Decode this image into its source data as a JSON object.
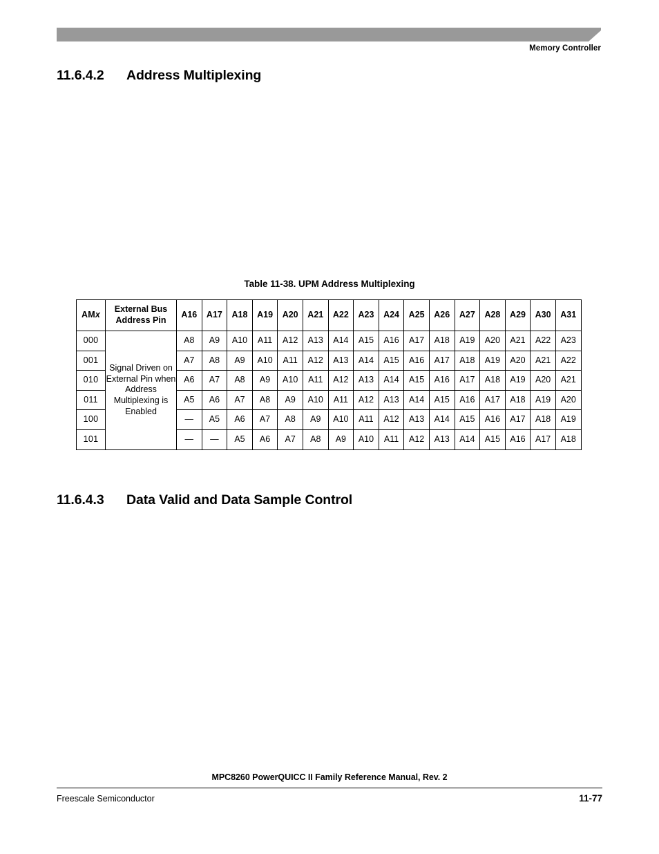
{
  "page": {
    "running_head": "Memory Controller",
    "banner_color": "#999999"
  },
  "sections": [
    {
      "number": "11.6.4.2",
      "title": "Address Multiplexing"
    },
    {
      "number": "11.6.4.3",
      "title": "Data Valid and Data Sample Control"
    }
  ],
  "table": {
    "caption": "Table 11-38. UPM Address Multiplexing",
    "headers": {
      "amx": "AM",
      "amx_italic_suffix": "x",
      "description": "External Bus Address Pin",
      "address_pins": [
        "A16",
        "A17",
        "A18",
        "A19",
        "A20",
        "A21",
        "A22",
        "A23",
        "A24",
        "A25",
        "A26",
        "A27",
        "A28",
        "A29",
        "A30",
        "A31"
      ]
    },
    "merged_description": "Signal Driven on External Pin when Address Multiplexing is Enabled",
    "rows": [
      {
        "amx": "000",
        "values": [
          "A8",
          "A9",
          "A10",
          "A11",
          "A12",
          "A13",
          "A14",
          "A15",
          "A16",
          "A17",
          "A18",
          "A19",
          "A20",
          "A21",
          "A22",
          "A23"
        ]
      },
      {
        "amx": "001",
        "values": [
          "A7",
          "A8",
          "A9",
          "A10",
          "A11",
          "A12",
          "A13",
          "A14",
          "A15",
          "A16",
          "A17",
          "A18",
          "A19",
          "A20",
          "A21",
          "A22"
        ]
      },
      {
        "amx": "010",
        "values": [
          "A6",
          "A7",
          "A8",
          "A9",
          "A10",
          "A11",
          "A12",
          "A13",
          "A14",
          "A15",
          "A16",
          "A17",
          "A18",
          "A19",
          "A20",
          "A21"
        ]
      },
      {
        "amx": "011",
        "values": [
          "A5",
          "A6",
          "A7",
          "A8",
          "A9",
          "A10",
          "A11",
          "A12",
          "A13",
          "A14",
          "A15",
          "A16",
          "A17",
          "A18",
          "A19",
          "A20"
        ]
      },
      {
        "amx": "100",
        "values": [
          "—",
          "A5",
          "A6",
          "A7",
          "A8",
          "A9",
          "A10",
          "A11",
          "A12",
          "A13",
          "A14",
          "A15",
          "A16",
          "A17",
          "A18",
          "A19"
        ]
      },
      {
        "amx": "101",
        "values": [
          "—",
          "—",
          "A5",
          "A6",
          "A7",
          "A8",
          "A9",
          "A10",
          "A11",
          "A12",
          "A13",
          "A14",
          "A15",
          "A16",
          "A17",
          "A18"
        ]
      }
    ]
  },
  "footer": {
    "manual_title": "MPC8260 PowerQUICC II Family Reference Manual, Rev. 2",
    "company": "Freescale Semiconductor",
    "page_number": "11-77"
  }
}
